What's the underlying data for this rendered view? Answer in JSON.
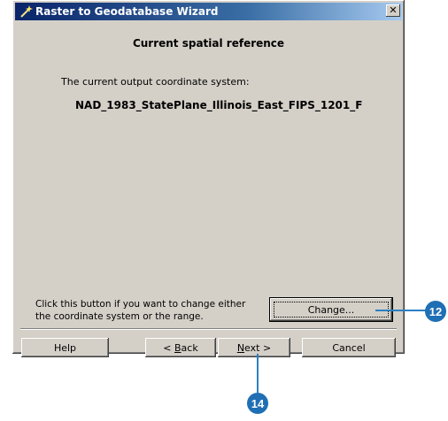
{
  "window": {
    "title": "Raster to Geodatabase Wizard",
    "close_glyph": "✕"
  },
  "main": {
    "heading": "Current spatial reference",
    "coord_label": "The current output coordinate system:",
    "coord_value": "NAD_1983_StatePlane_Illinois_East_FIPS_1201_F",
    "hint_line1": "Click this button if you want to change either",
    "hint_line2": "the coordinate system or the range.",
    "change_button": "Change..."
  },
  "footer": {
    "help": "Help",
    "back_prefix": "< ",
    "back_mnemonic": "B",
    "back_rest": "ack",
    "next_mnemonic": "N",
    "next_rest": "ext >",
    "cancel": "Cancel"
  },
  "callouts": {
    "change": "12",
    "next": "14"
  },
  "colors": {
    "callout": "#1f6fb5",
    "titlebar": "#0a246a",
    "dialog": "#d4d0c8"
  }
}
